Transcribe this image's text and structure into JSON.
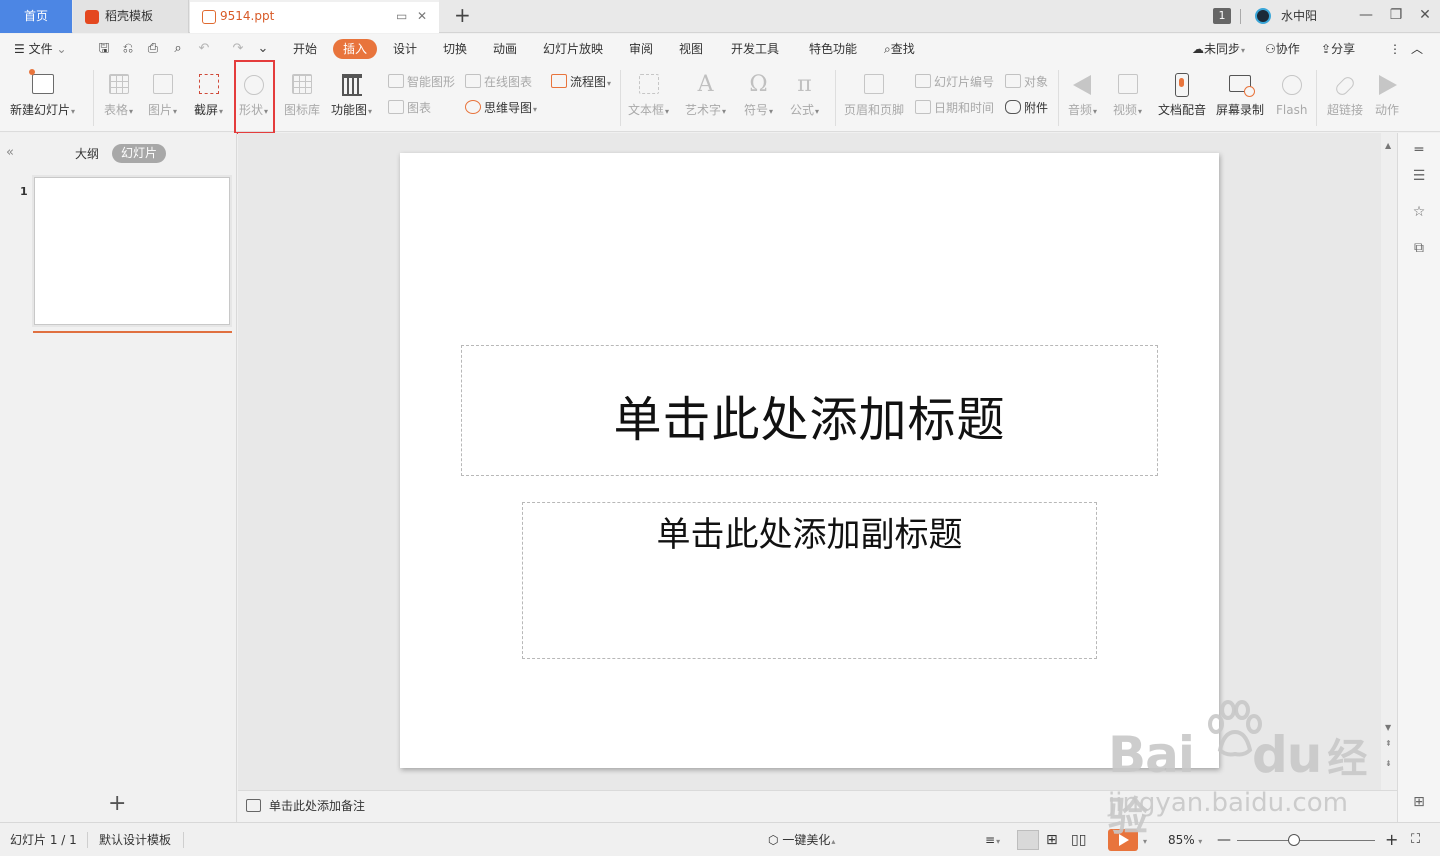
{
  "tabs": {
    "home": "首页",
    "template": "稻壳模板",
    "document": "9514.ppt"
  },
  "titlebar": {
    "badge": "1",
    "username": "水中阳"
  },
  "menu": {
    "file": "文件",
    "items": [
      "开始",
      "插入",
      "设计",
      "切换",
      "动画",
      "幻灯片放映",
      "审阅",
      "视图",
      "开发工具",
      "特色功能"
    ],
    "active": "插入",
    "search": "查找",
    "sync": "未同步",
    "collab": "协作",
    "share": "分享"
  },
  "ribbon": {
    "new_slide": "新建幻灯片",
    "table": "表格",
    "picture": "图片",
    "screenshot": "截屏",
    "shape": "形状",
    "icon_lib": "图标库",
    "func_chart": "功能图",
    "smart_art": "智能图形",
    "online_chart": "在线图表",
    "chart": "图表",
    "flowchart": "流程图",
    "mindmap": "思维导图",
    "textbox": "文本框",
    "wordart": "艺术字",
    "symbol": "符号",
    "formula": "公式",
    "header_footer": "页眉和页脚",
    "slide_number": "幻灯片编号",
    "object": "对象",
    "date_time": "日期和时间",
    "attachment": "附件",
    "audio": "音频",
    "video": "视频",
    "doc_dub": "文档配音",
    "screen_rec": "屏幕录制",
    "flash": "Flash",
    "hyperlink": "超链接",
    "action": "动作"
  },
  "left_panel": {
    "outline": "大纲",
    "slides": "幻灯片",
    "thumb_number": "1"
  },
  "slide": {
    "title_placeholder": "单击此处添加标题",
    "subtitle_placeholder": "单击此处添加副标题"
  },
  "notes": {
    "placeholder": "单击此处添加备注"
  },
  "status": {
    "slide_count": "幻灯片 1 / 1",
    "template": "默认设计模板",
    "beautify": "一键美化",
    "zoom": "85%"
  },
  "watermark": {
    "logo": "Bai",
    "logo2": "du",
    "logo_cn": "经验",
    "url": "jingyan.baidu.com"
  },
  "colors": {
    "accent": "#e8743c",
    "home_tab": "#4c86e4",
    "highlight": "#e43c3c"
  }
}
